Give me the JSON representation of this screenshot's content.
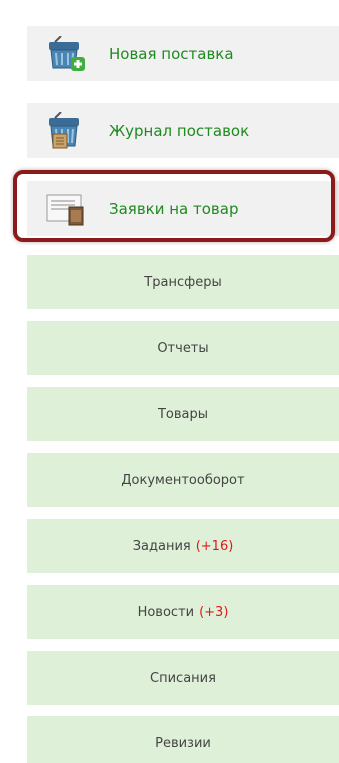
{
  "menu": {
    "top_items": [
      {
        "label": "Новая поставка",
        "icon": "basket-add-icon"
      },
      {
        "label": "Журнал поставок",
        "icon": "basket-journal-icon"
      },
      {
        "label": "Заявки на товар",
        "icon": "document-request-icon"
      }
    ],
    "items": [
      {
        "label": "Трансферы"
      },
      {
        "label": "Отчеты"
      },
      {
        "label": "Товары"
      },
      {
        "label": "Документооборот"
      },
      {
        "label": "Задания",
        "badge": "(+16)"
      },
      {
        "label": "Новости",
        "badge": "(+3)"
      },
      {
        "label": "Списания"
      },
      {
        "label": "Ревизии"
      }
    ]
  },
  "colors": {
    "icon_item_label": "#1f8a1f",
    "plain_item_bg": "#dff0d8",
    "badge": "#e01818",
    "highlight_border": "#8b1a1a"
  }
}
